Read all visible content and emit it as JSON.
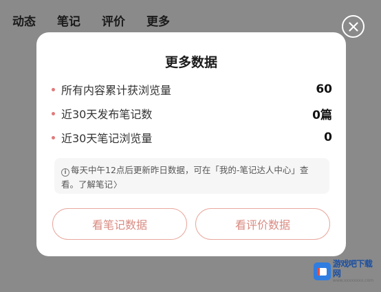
{
  "background_tabs": [
    "动态",
    "笔记",
    "评价",
    "更多"
  ],
  "modal": {
    "title": "更多数据",
    "stats": [
      {
        "label": "所有内容累计获浏览量",
        "value": "60"
      },
      {
        "label": "近30天发布笔记数",
        "value": "0篇"
      },
      {
        "label": "近30天笔记浏览量",
        "value": "0"
      }
    ],
    "note_icon": "i",
    "note_text": "每天中午12点后更新昨日数据，可在「我的-笔记达人中心」查看。",
    "note_link": "了解笔记",
    "note_chevron": "〉",
    "buttons": {
      "notes": "看笔记数据",
      "reviews": "看评价数据"
    }
  },
  "watermark": {
    "name": "游戏吧下载网",
    "url": "www.xxxxxxxx.com"
  },
  "colors": {
    "accent": "#e9a79d",
    "accent_text": "#d98b82",
    "overlay": "#8a8a8a"
  }
}
